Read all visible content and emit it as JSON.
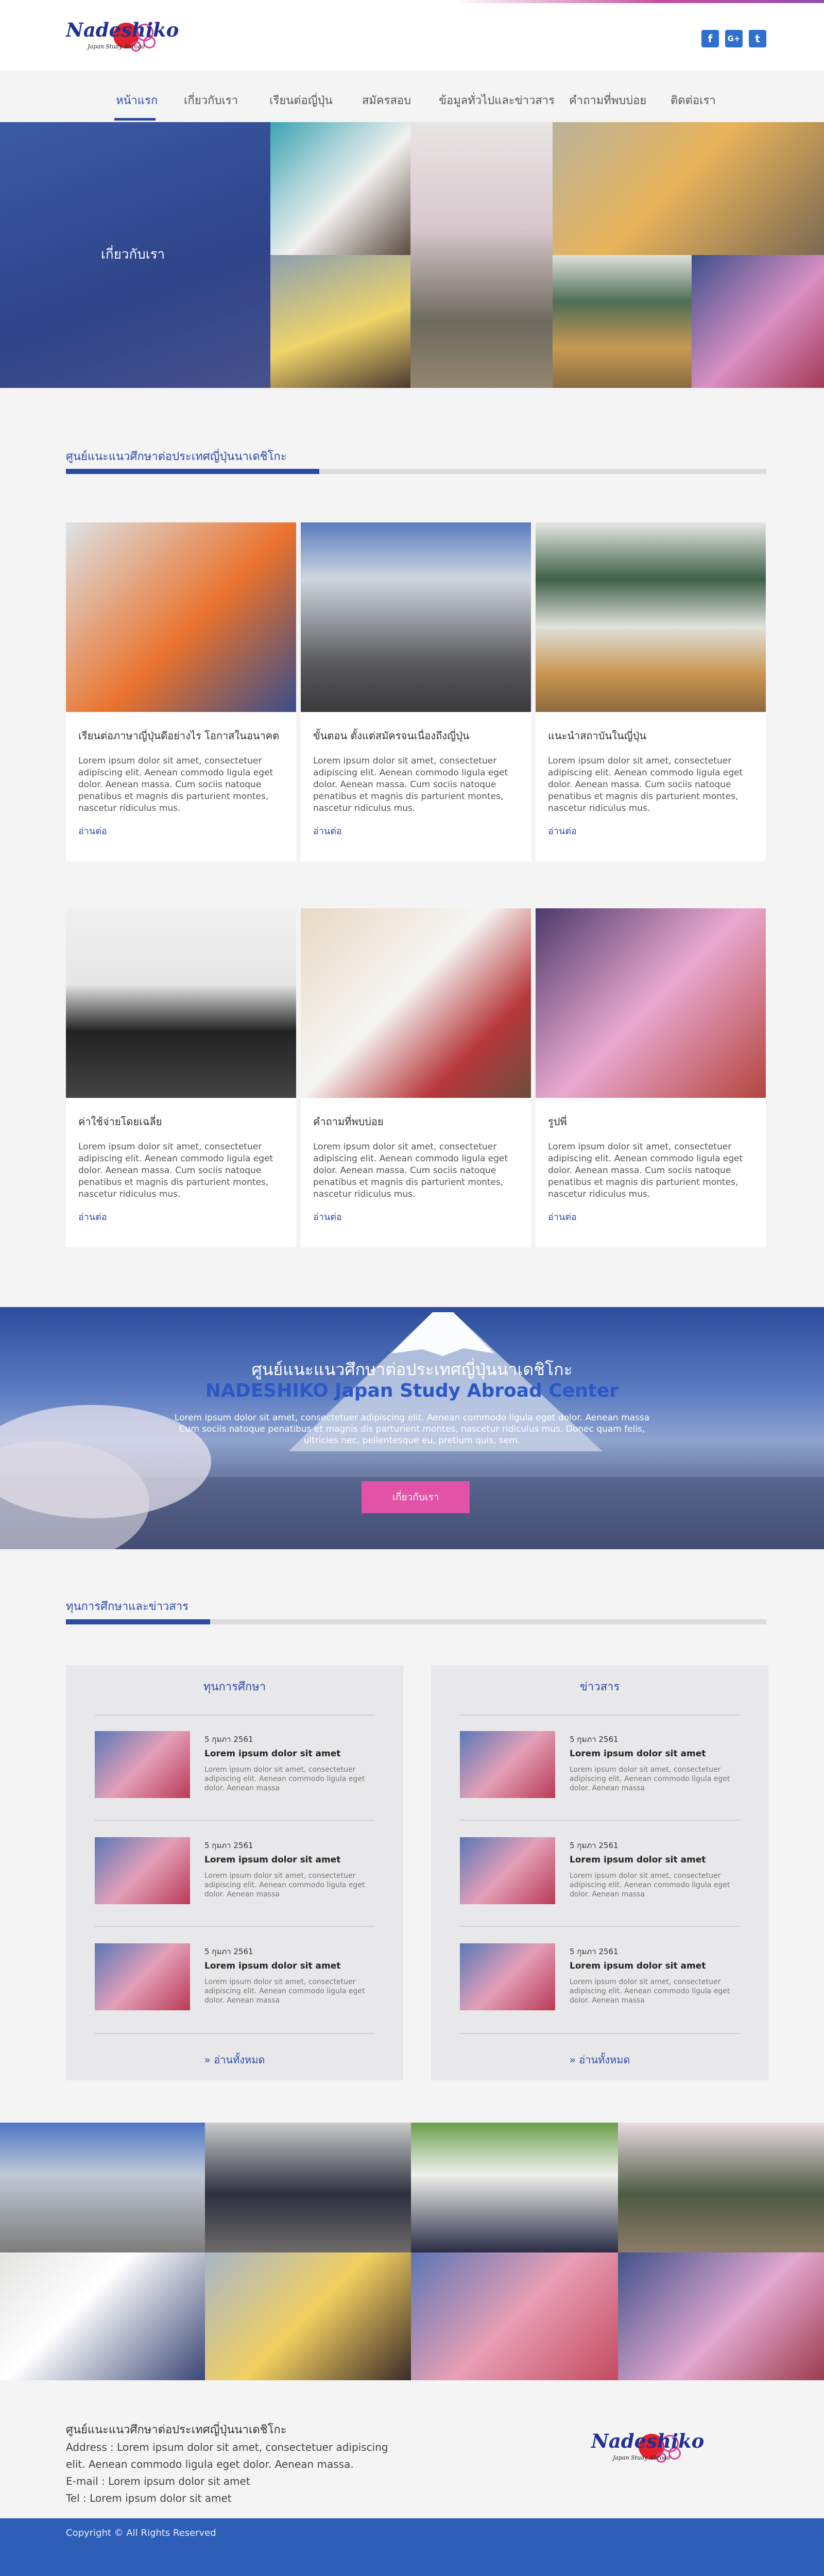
{
  "colors": {
    "brand": "#2d4aa3",
    "accent": "#e252a7",
    "footer_bar": "#2d5fb8"
  },
  "header": {
    "logo_word": "Nadeshiko",
    "logo_sub": "Japan Study Abroad",
    "social": [
      {
        "icon": "facebook-icon",
        "glyph": "f"
      },
      {
        "icon": "google-plus-icon",
        "glyph": "G+"
      },
      {
        "icon": "twitter-icon",
        "glyph": "t"
      }
    ]
  },
  "nav": {
    "items": [
      "หน้าแรก",
      "เกี่ยวกับเรา",
      "เรียนต่อญี่ปุ่น",
      "สมัครสอบ",
      "ข้อมูลทั่วไปและข่าวสาร",
      "คำถามที่พบบ่อย",
      "ติดต่อเรา"
    ],
    "active": 0
  },
  "hero": {
    "label": "เกี่ยวกับเรา"
  },
  "section1": {
    "title": "ศูนย์แนะแนวศึกษาต่อประเทศญี่ปุ่นนาเดชิโกะ",
    "cards": [
      {
        "title": "เรียนต่อภาษาญี่ปุ่นดีอย่างไร โอกาสในอนาคต",
        "desc": "Lorem ipsum dolor sit amet, consectetuer adipiscing elit. Aenean commodo ligula eget dolor. Aenean massa. Cum sociis natoque penatibus et magnis dis parturient montes, nascetur ridiculus mus.",
        "more": "อ่านต่อ"
      },
      {
        "title": "ขั้นตอน ตั้งแต่สมัครจนเนื่องถึงญี่ปุ่น",
        "desc": "Lorem ipsum dolor sit amet, consectetuer adipiscing elit. Aenean commodo ligula eget dolor. Aenean massa. Cum sociis natoque penatibus et magnis dis parturient montes, nascetur ridiculus mus.",
        "more": "อ่านต่อ"
      },
      {
        "title": "แนะนำสถาบันในญี่ปุ่น",
        "desc": "Lorem ipsum dolor sit amet, consectetuer adipiscing elit. Aenean commodo ligula eget dolor. Aenean massa. Cum sociis natoque penatibus et magnis dis parturient montes, nascetur ridiculus mus.",
        "more": "อ่านต่อ"
      },
      {
        "title": "ค่าใช้จ่ายโดยเฉลี่ย",
        "desc": "Lorem ipsum dolor sit amet, consectetuer adipiscing elit. Aenean commodo ligula eget dolor. Aenean massa. Cum sociis natoque penatibus et magnis dis parturient montes, nascetur ridiculus mus.",
        "more": "อ่านต่อ"
      },
      {
        "title": "คำถามที่พบบ่อย",
        "desc": "Lorem ipsum dolor sit amet, consectetuer adipiscing elit. Aenean commodo ligula eget dolor. Aenean massa. Cum sociis natoque penatibus et magnis dis parturient montes, nascetur ridiculus mus.",
        "more": "อ่านต่อ"
      },
      {
        "title": "รูปพี่",
        "desc": "Lorem ipsum dolor sit amet, consectetuer adipiscing elit. Aenean commodo ligula eget dolor. Aenean massa. Cum sociis natoque penatibus et magnis dis parturient montes, nascetur ridiculus mus.",
        "more": "อ่านต่อ"
      }
    ]
  },
  "banner": {
    "line1": "ศูนย์แนะแนวศึกษาต่อประเทศญี่ปุ่นนาเดชิโกะ",
    "line2": "NADESHIKO Japan Study Abroad Center",
    "line3": "Lorem ipsum dolor sit amet, consectetuer adipiscing elit. Aenean commodo ligula eget dolor. Aenean massa Cum sociis natoque penatibus et magnis dis parturient montes, nascetur ridiculus mus. Donec quam felis, ultricies nec, pellentesque eu, pretium quis, sem.",
    "button": "เกี่ยวกับเรา"
  },
  "section2": {
    "title": "ทุนการศึกษาและข่าวสาร",
    "panels": [
      {
        "heading": "ทุนการศึกษา",
        "all": "» อ่านทั้งหมด",
        "items": [
          {
            "date": "5 กุมภา 2561",
            "title": "Lorem ipsum dolor sit amet",
            "desc": "Lorem ipsum dolor sit amet, consectetuer adipiscing elit. Aenean commodo ligula eget dolor. Aenean massa"
          },
          {
            "date": "5 กุมภา 2561",
            "title": "Lorem ipsum dolor sit amet",
            "desc": "Lorem ipsum dolor sit amet, consectetuer adipiscing elit. Aenean commodo ligula eget dolor. Aenean massa"
          },
          {
            "date": "5 กุมภา 2561",
            "title": "Lorem ipsum dolor sit amet",
            "desc": "Lorem ipsum dolor sit amet, consectetuer adipiscing elit. Aenean commodo ligula eget dolor. Aenean massa"
          }
        ]
      },
      {
        "heading": "ข่าวสาร",
        "all": "» อ่านทั้งหมด",
        "items": [
          {
            "date": "5 กุมภา 2561",
            "title": "Lorem ipsum dolor sit amet",
            "desc": "Lorem ipsum dolor sit amet, consectetuer adipiscing elit. Aenean commodo ligula eget dolor. Aenean massa"
          },
          {
            "date": "5 กุมภา 2561",
            "title": "Lorem ipsum dolor sit amet",
            "desc": "Lorem ipsum dolor sit amet, consectetuer adipiscing elit. Aenean commodo ligula eget dolor. Aenean massa"
          },
          {
            "date": "5 กุมภา 2561",
            "title": "Lorem ipsum dolor sit amet",
            "desc": "Lorem ipsum dolor sit amet, consectetuer adipiscing elit. Aenean commodo ligula eget dolor. Aenean massa"
          }
        ]
      }
    ]
  },
  "footer": {
    "heading": "ศูนย์แนะแนวศึกษาต่อประเทศญี่ปุ่นนาเดชิโกะ",
    "address1": "Address : Lorem ipsum dolor sit amet, consectetuer adipiscing",
    "address2": "elit. Aenean commodo ligula eget dolor. Aenean massa.",
    "email": "E-mail : Lorem ipsum dolor sit amet",
    "tel": "Tel : Lorem ipsum dolor sit amet",
    "copyright": "Copyright © All Rights Reserved"
  }
}
